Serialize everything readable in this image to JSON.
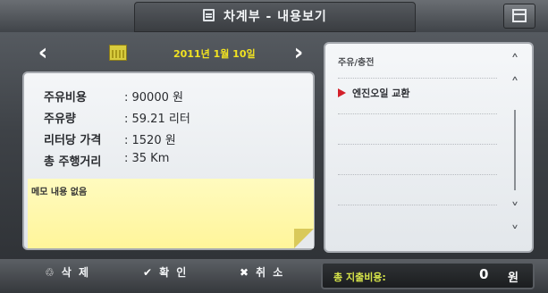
{
  "window": {
    "title": "차계부 - 내용보기",
    "title_icon": "list-icon",
    "calendar_button_icon": "calendar-icon"
  },
  "date_nav": {
    "prev_icon": "chevron-left-icon",
    "next_icon": "chevron-right-icon",
    "date": "2011년 1월 10일",
    "date_color": "#f2e321"
  },
  "info": {
    "fields": [
      {
        "label": "주유비용",
        "value": ": 90000 원"
      },
      {
        "label": "주유량",
        "value": ": 59.21 리터"
      },
      {
        "label": "리터당 가격",
        "value": ": 1520 원"
      },
      {
        "label": "총 주행거리",
        "value": ": 35 Km"
      }
    ],
    "memo": "메모 내용 없음"
  },
  "list": {
    "header": "주유/충전",
    "items": [
      {
        "label": "엔진오일 교환",
        "accent": "#d3202a"
      }
    ],
    "scroll_top_icon": "double-chevron-up-icon",
    "scroll_up_icon": "chevron-up-icon",
    "scroll_down_icon": "chevron-down-icon",
    "scroll_bottom_icon": "double-chevron-down-icon"
  },
  "bottom": {
    "delete_label": "삭 제",
    "confirm_label": "확 인",
    "cancel_label": "취 소",
    "total_label": "총 지출비용:",
    "total_value": "0",
    "total_unit": "원",
    "total_color": "#d8e64a"
  }
}
